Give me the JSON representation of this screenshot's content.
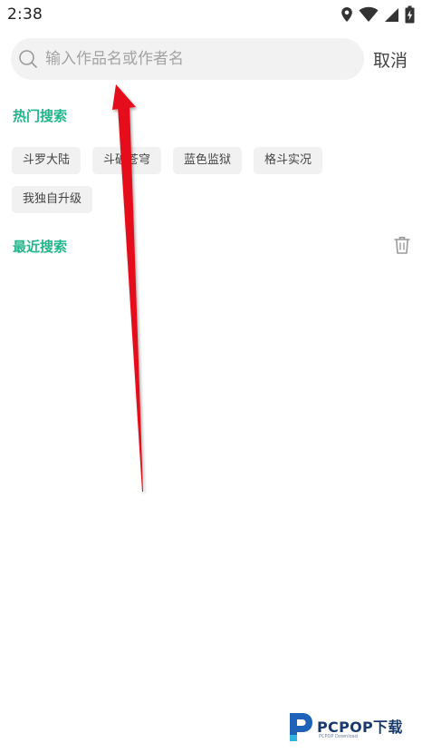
{
  "status_bar": {
    "time": "2:38",
    "icons": [
      "location-icon",
      "wifi-icon",
      "signal-icon",
      "battery-icon"
    ]
  },
  "search": {
    "placeholder": "输入作品名或作者名",
    "value": "",
    "cancel_label": "取消"
  },
  "hot_search": {
    "title": "热门搜索",
    "tags": [
      "斗罗大陆",
      "斗破苍穹",
      "蓝色监狱",
      "格斗实况",
      "我独自升级"
    ]
  },
  "recent_search": {
    "title": "最近搜索",
    "clear_icon": "trash-icon",
    "items": []
  },
  "watermark": {
    "brand": "PCPOP下载",
    "sub": "PCPOP Download"
  },
  "colors": {
    "accent": "#24b58c",
    "search_bg": "#f2f2f2",
    "tag_bg": "#f1f1f1",
    "annotation": "#e5111b"
  }
}
